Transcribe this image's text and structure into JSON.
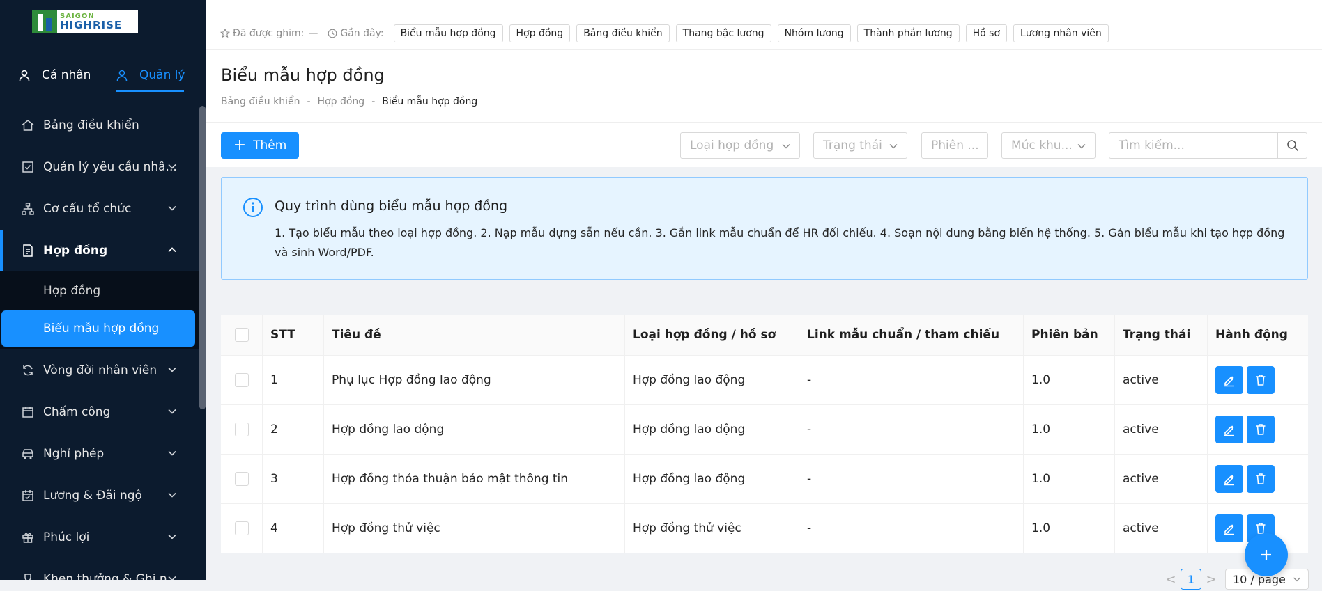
{
  "brand": {
    "line1": "SAIGON",
    "line2": "HIGHRISE"
  },
  "mode_tabs": {
    "personal": "Cá nhân",
    "manage": "Quản lý"
  },
  "nav": {
    "dashboard": "Bảng điều khiển",
    "requests": "Quản lý yêu cầu nhâ...",
    "org": "Cơ cấu tổ chức",
    "contracts": "Hợp đồng",
    "contracts_sub": [
      "Hợp đồng",
      "Biểu mẫu hợp đồng"
    ],
    "lifecycle": "Vòng đời nhân viên",
    "attendance": "Chấm công",
    "leave": "Nghỉ phép",
    "salary": "Lương & Đãi ngộ",
    "benefits": "Phúc lợi",
    "rewards": "Khen thưởng & Ghi n..."
  },
  "recent_bar": {
    "pinned_label": "Đã được ghim:",
    "pinned_value": "—",
    "recent_label": "Gần đây:",
    "chips": [
      "Biểu mẫu hợp đồng",
      "Hợp đồng",
      "Bảng điều khiển",
      "Thang bậc lương",
      "Nhóm lương",
      "Thành phần lương",
      "Hồ sơ",
      "Lương nhân viên"
    ]
  },
  "page": {
    "title": "Biểu mẫu hợp đồng",
    "breadcrumb": [
      "Bảng điều khiển",
      "-",
      "Hợp đồng",
      "-",
      "Biểu mẫu hợp đồng"
    ]
  },
  "toolbar": {
    "add_label": "Thêm",
    "filter_contract_type": "Loại hợp đồng",
    "filter_status": "Trạng thái",
    "filter_version": "Phiên ...",
    "filter_level": "Mức khu...",
    "search_placeholder": "Tìm kiếm..."
  },
  "info": {
    "title": "Quy trình dùng biểu mẫu hợp đồng",
    "desc": "1. Tạo biểu mẫu theo loại hợp đồng. 2. Nạp mẫu dựng sẵn nếu cần. 3. Gắn link mẫu chuẩn để HR đối chiếu. 4. Soạn nội dung bằng biến hệ thống. 5. Gán biểu mẫu khi tạo hợp đồng và sinh Word/PDF."
  },
  "table": {
    "headers": [
      "STT",
      "Tiêu đề",
      "Loại hợp đồng / hồ sơ",
      "Link mẫu chuẩn / tham chiếu",
      "Phiên bản",
      "Trạng thái",
      "Hành động"
    ],
    "rows": [
      [
        "1",
        "Phụ lục Hợp đồng lao động",
        "Hợp đồng lao động",
        "-",
        "1.0",
        "active"
      ],
      [
        "2",
        "Hợp đồng lao động",
        "Hợp đồng lao động",
        "-",
        "1.0",
        "active"
      ],
      [
        "3",
        "Hợp đồng thỏa thuận bảo mật thông tin",
        "Hợp đồng lao động",
        "-",
        "1.0",
        "active"
      ],
      [
        "4",
        "Hợp đồng thử việc",
        "Hợp đồng thử việc",
        "-",
        "1.0",
        "active"
      ]
    ]
  },
  "pagination": {
    "prev": "<",
    "current": "1",
    "next": ">",
    "page_size": "10 / page"
  },
  "colors": {
    "primary": "#1890ff",
    "sidebar_bg": "#0c1b2e",
    "info_bg": "#e6f4ff"
  }
}
